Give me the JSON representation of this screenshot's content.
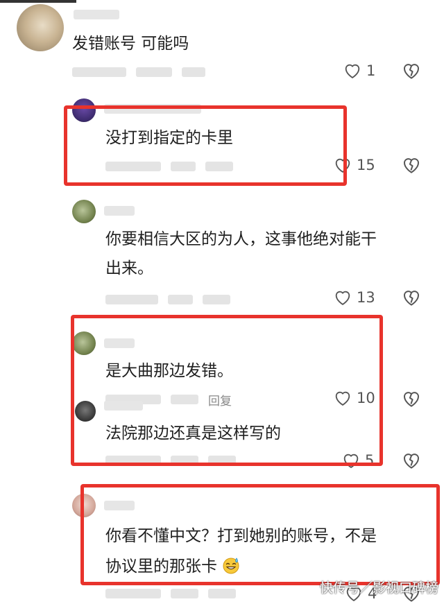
{
  "comments": [
    {
      "text": "发错账号 可能吗",
      "likes": "1"
    },
    {
      "text": "没打到指定的卡里",
      "likes": "15"
    },
    {
      "text_line1": "你要相信大区的为人，这事他绝对能干",
      "text_line2": "出来。",
      "likes": "13"
    },
    {
      "text": "是大曲那边发错。",
      "reply_label": "回复",
      "likes": "10"
    },
    {
      "text": "法院那边还真是这样写的",
      "likes": "5"
    },
    {
      "text_line1": "你看不懂中文？打到她别的账号，不是",
      "text_line2": "协议里的那张卡",
      "emoji": "sweat-smile-emoji",
      "likes": "4"
    }
  ],
  "watermark": "快传号／影视口碑榜",
  "colors": {
    "highlight_box": "#e8332c",
    "icon": "#555555"
  },
  "icons": {
    "like": "heart-outline-icon",
    "dislike": "broken-heart-icon"
  }
}
